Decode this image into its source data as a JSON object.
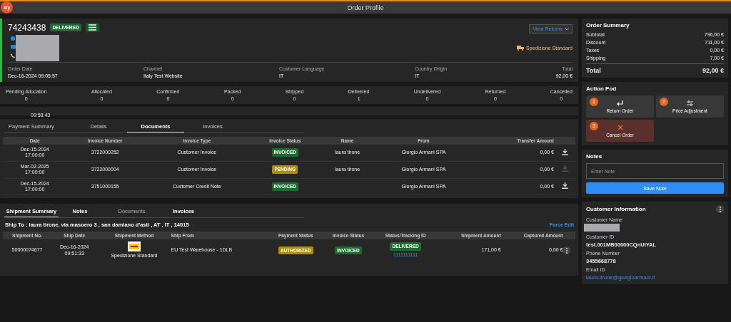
{
  "window": {
    "title": "Order Profile",
    "logo": "x/y"
  },
  "order": {
    "number": "74243438",
    "status": "DELIVERED",
    "view_returns": "View Returns",
    "shipping_method": "Spedizione Standard",
    "fields": [
      {
        "label": "Order Date",
        "value": "Dec-16-2024 09:05:57"
      },
      {
        "label": "Channel",
        "value": "Italy Test Website"
      },
      {
        "label": "Customer Language",
        "value": "IT"
      },
      {
        "label": "Country Origin",
        "value": "IT"
      },
      {
        "label": "Total",
        "value": "92,00 €"
      }
    ]
  },
  "counts": [
    {
      "label": "Pending Allocation",
      "value": "0"
    },
    {
      "label": "Allocated",
      "value": "0"
    },
    {
      "label": "Confirmed",
      "value": "0"
    },
    {
      "label": "Packed",
      "value": "0"
    },
    {
      "label": "Shipped",
      "value": "0"
    },
    {
      "label": "Delivered",
      "value": "1"
    },
    {
      "label": "Undelivered",
      "value": "0"
    },
    {
      "label": "Returned",
      "value": "0"
    },
    {
      "label": "Cancelled",
      "value": "0"
    }
  ],
  "partial_row": {
    "time": "09:58:43"
  },
  "documents": {
    "tabs": [
      {
        "label": "Payment Summary",
        "selected": false
      },
      {
        "label": "Details",
        "selected": false
      },
      {
        "label": "Documents",
        "selected": true
      },
      {
        "label": "Invoices",
        "selected": false
      }
    ],
    "columns": [
      "Date",
      "Invoice Number",
      "Invoice Type",
      "Invoice Status",
      "Name",
      "From",
      "Transfer Amount"
    ],
    "rows": [
      {
        "date": "Dec-15-2024",
        "time": "17:00:00",
        "number": "3722000252",
        "type": "Customer Invoice",
        "status": "INVOICED",
        "color": "#1d6b31",
        "name": "laura tirone",
        "from": "Giorgio Armani SPA",
        "amount": "0,00 €",
        "download_disabled": false
      },
      {
        "date": "Mar-02-2025",
        "time": "17:00:00",
        "number": "3722000004",
        "type": "Customer Invoice",
        "status": "PENDING",
        "color": "#b38c00",
        "name": "laura tirone",
        "from": "Giorgio Armani SPA",
        "amount": "0,00 €",
        "download_disabled": true
      },
      {
        "date": "Dec-15-2024",
        "time": "17:00:00",
        "number": "3751000155",
        "type": "Customer Credit Note",
        "status": "INVOICED",
        "color": "#1d6b31",
        "from": "Giorgio Armani SPA",
        "amount": "0,00 €",
        "download_disabled": false
      }
    ]
  },
  "shipments": {
    "tabs": [
      {
        "label": "Shipment Summary",
        "selected": true
      },
      {
        "label": "Notes",
        "selected": false
      },
      {
        "label": "Documents",
        "selected": false
      },
      {
        "label": "Invoices",
        "selected": false
      }
    ],
    "ship_to": "Ship To : laura tirone, via masoero 3 , san damiano d'asti , AT , IT , 14015",
    "force_edit": "Force Edit",
    "columns": [
      "Shipment No.",
      "Ship Date",
      "Shipment Method",
      "Ship From",
      "Payment Status",
      "Invoice Status",
      "Status/Tracking ID",
      "Shipment Amount",
      "Captured Amount"
    ],
    "rows": [
      {
        "number": "50000074677",
        "date": "Dec-16-2024",
        "time": "09:51:33",
        "method": "Spedizione Standard",
        "from": "EU Test Warehouse - 1DLB",
        "payment": {
          "status": "AUTHORIZED",
          "color": "#b38c00"
        },
        "invoice": {
          "status": "INVOICED",
          "color": "#1d6b31"
        },
        "delivery": {
          "status": "DELIVERED",
          "color": "#1d6b31"
        },
        "tracking": "1111111111",
        "amount": "171,00 €",
        "captured": "0,00 €"
      }
    ]
  },
  "order_summary": {
    "title": "Order Summary",
    "lines": [
      {
        "label": "Subtotal",
        "value": "796,00 €"
      },
      {
        "label": "Discount",
        "value": "711,00 €"
      },
      {
        "label": "Taxes",
        "value": "0,00 €"
      },
      {
        "label": "Shipping",
        "value": "7,00 €"
      }
    ],
    "total_label": "Total",
    "total_value": "92,00 €"
  },
  "action_pod": {
    "title": "Action Pod",
    "actions": [
      {
        "number": "1",
        "label": "Return Order",
        "kind": "return"
      },
      {
        "number": "2",
        "label": "Price Adjustment",
        "kind": "adjust"
      },
      {
        "number": "3",
        "label": "Cancel Order",
        "kind": "cancel"
      }
    ]
  },
  "notes": {
    "title": "Notes",
    "placeholder": "Enter Note",
    "button": "Save Note"
  },
  "customer": {
    "title": "Customer Information",
    "fields": [
      {
        "label": "Customer Name",
        "kind": "redacted"
      },
      {
        "label": "Customer ID",
        "value": "test.001MB00000CQnUiYAL",
        "kind": "text"
      },
      {
        "label": "Phone Number",
        "value": "3455668778",
        "kind": "text"
      },
      {
        "label": "Email ID",
        "value": "laura.tirone@giorgioarmani.it",
        "kind": "link"
      }
    ]
  }
}
